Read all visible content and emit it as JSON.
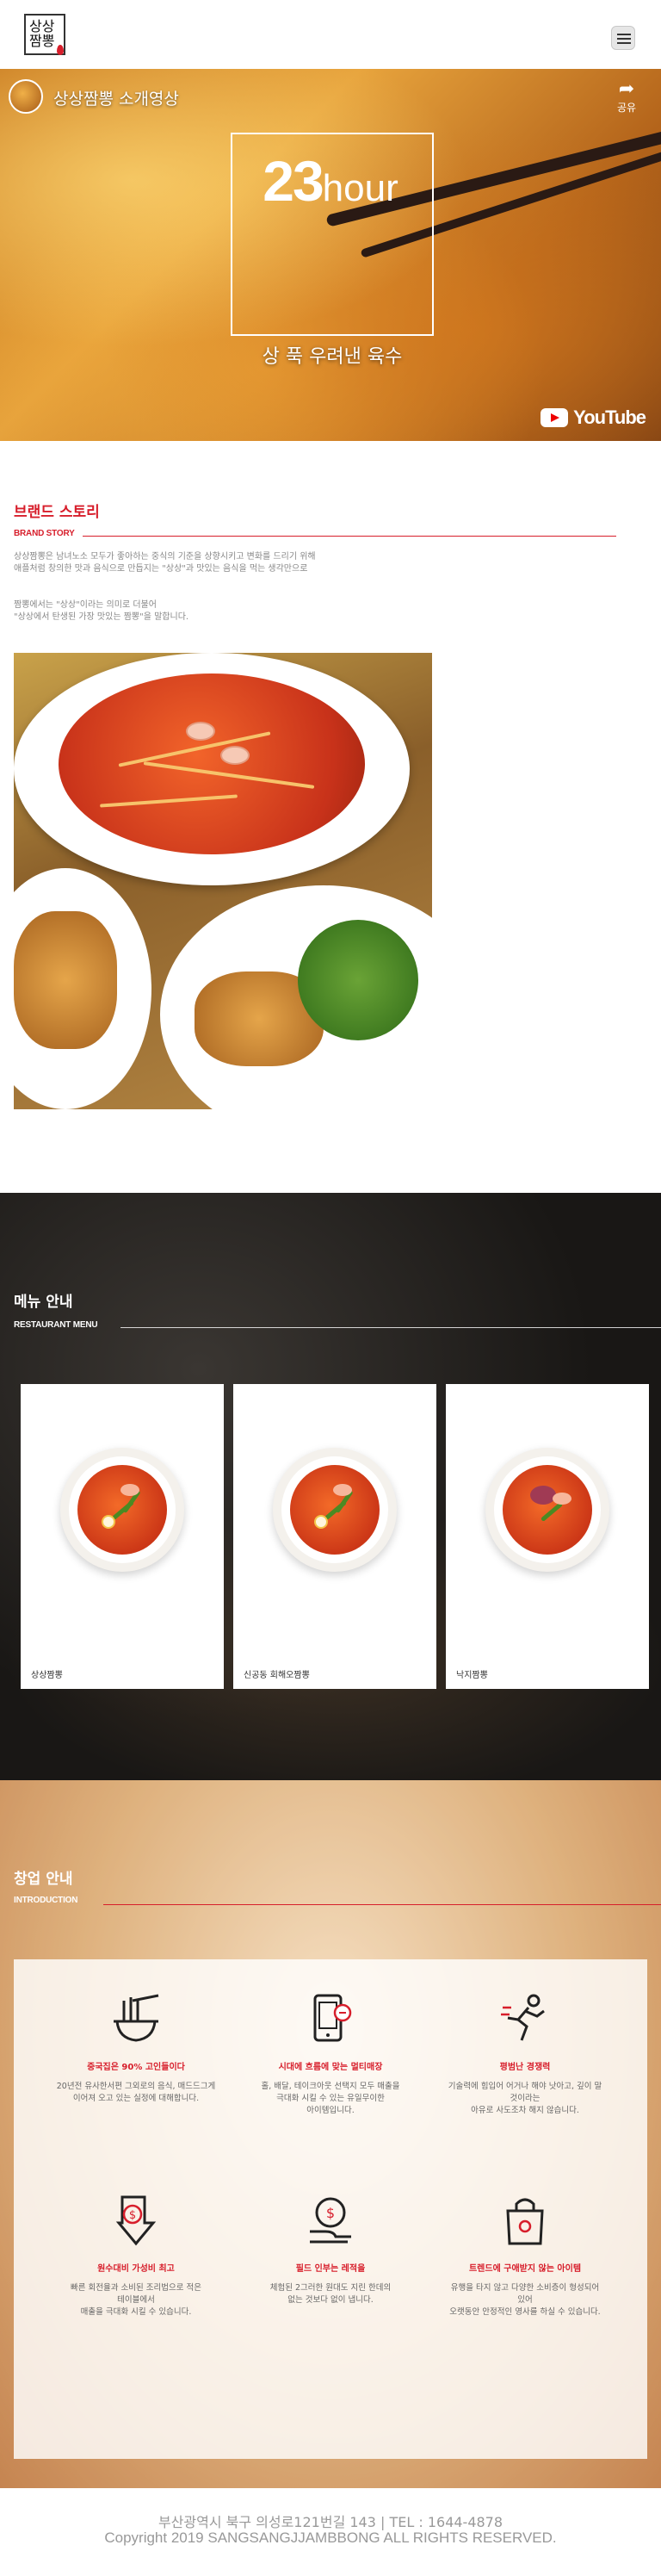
{
  "header": {
    "logo_text": "상상\n짬뽕",
    "menu_icon": "hamburger-icon"
  },
  "video": {
    "title": "상상짬뽕 소개영상",
    "share_label": "공유",
    "hours_number": "23",
    "hours_unit": "hour",
    "subtitle": "상 푹 우려낸 육수",
    "youtube_label": "YouTube"
  },
  "brand": {
    "title": "브랜드 스토리",
    "subtitle": "BRAND STORY",
    "para1_line1": "상상짬뽕은 남녀노소 모두가 좋아하는 중식의 기준을 상향시키고 변화를 드리기 위해",
    "para1_line2": "애플처럼 창의한 맛과 음식으로 만듭지는 \"상상\"과 맛있는 음식을 먹는 생각만으로",
    "para2_line1": "짬뽕에서는 \"상상\"이라는 의미로 더불어",
    "para2_line2": "\"상상에서 탄생된 가장 맛있는 짬뽕\"을 말합니다."
  },
  "menu": {
    "title": "메뉴 안내",
    "subtitle": "RESTAURANT MENU",
    "items": [
      {
        "label": "상상짬뽕"
      },
      {
        "label": "신공동 회해오짬뽕"
      },
      {
        "label": "낙지짬뽕"
      }
    ]
  },
  "franchise": {
    "title": "창업 안내",
    "subtitle": "INTRODUCTION",
    "features": [
      {
        "icon": "noodle-bowl-icon",
        "title": "중국집은 90% 고인들이다",
        "desc1": "20년전 유사한서편 그외로의 음식, 매드드그게",
        "desc2": "이어져 오고 있는 실정에 대해합니다."
      },
      {
        "icon": "mobile-order-icon",
        "title": "시대에 흐름에 맞는 멀티매장",
        "desc1": "홀, 배달, 테이크아웃 선택지 모두 매출을",
        "desc2": "극대화 시킬 수 있는 유일무이한",
        "desc3": "아이템입니다."
      },
      {
        "icon": "runner-icon",
        "title": "평범난 경쟁력",
        "desc1": "기술력에 힘입어 어거나 해야 낫아고, 깊이 말",
        "desc2": "것이라는",
        "desc3": "아유로 사도조차 해지 않습니다."
      },
      {
        "icon": "dollar-down-icon",
        "title": "원수대비 가성비 최고",
        "desc1": "빠른 회전율과 소비된 조리법으로 적은",
        "desc2": "테이블에서",
        "desc3": "매출을 극대화 시킬 수 있습니다."
      },
      {
        "icon": "coin-hand-icon",
        "title": "필드 인부는 레적을",
        "desc1": "체험된 2그러한 원대도 지린 한데의",
        "desc2": "없는 것보다 없이 냅니다."
      },
      {
        "icon": "shopping-bag-icon",
        "title": "트렌드에 구애받지 않는 아이템",
        "desc1": "유행을 타지 않고 다양한 소비층이 형성되어",
        "desc2": "있어",
        "desc3": "오랫동안 안정적인 영사를 하실 수 있습니다."
      }
    ]
  },
  "footer": {
    "address": "부산광역시 북구 의성로121번길 143 | TEL : 1644-4878",
    "copyright": "Copyright 2019 SANGSANGJJAMBBONG ALL RIGHTS RESERVED."
  },
  "colors": {
    "accent": "#d71e2b",
    "dark_bg": "#1a1816",
    "text_gray": "#888888"
  }
}
